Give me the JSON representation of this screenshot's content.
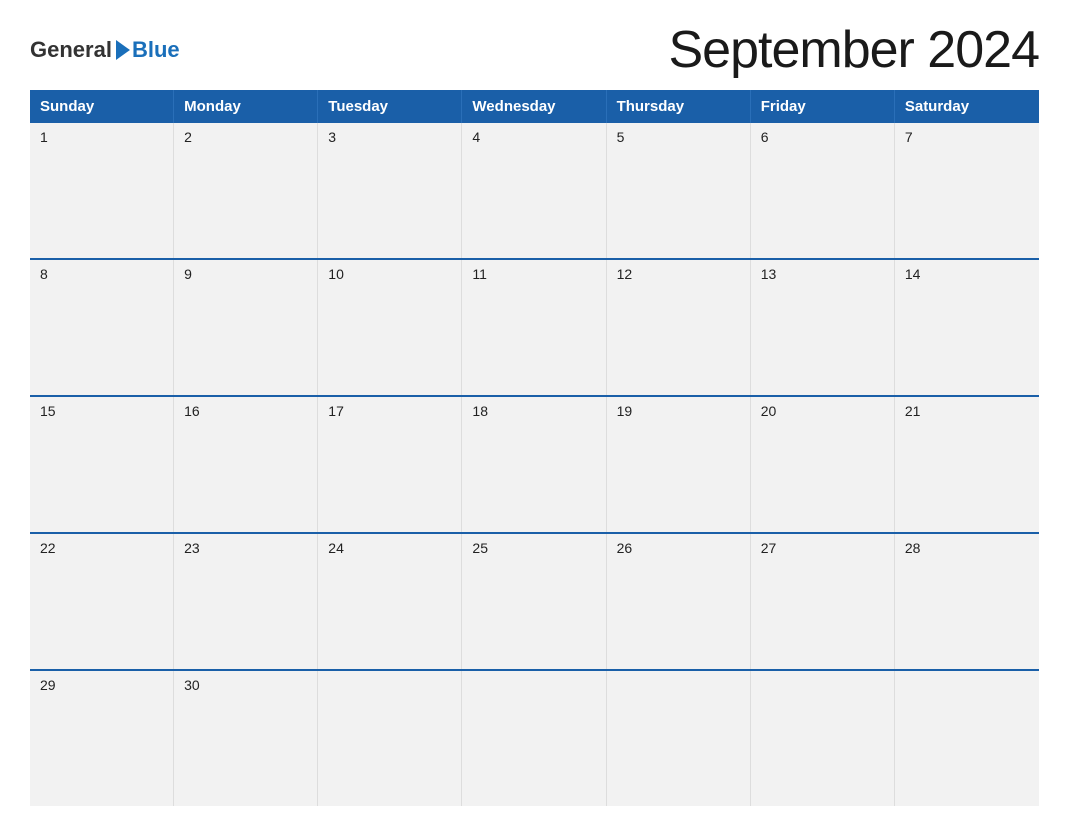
{
  "logo": {
    "general": "General",
    "blue": "Blue"
  },
  "title": "September 2024",
  "header": {
    "days": [
      "Sunday",
      "Monday",
      "Tuesday",
      "Wednesday",
      "Thursday",
      "Friday",
      "Saturday"
    ]
  },
  "weeks": [
    [
      {
        "day": "1"
      },
      {
        "day": "2"
      },
      {
        "day": "3"
      },
      {
        "day": "4"
      },
      {
        "day": "5"
      },
      {
        "day": "6"
      },
      {
        "day": "7"
      }
    ],
    [
      {
        "day": "8"
      },
      {
        "day": "9"
      },
      {
        "day": "10"
      },
      {
        "day": "11"
      },
      {
        "day": "12"
      },
      {
        "day": "13"
      },
      {
        "day": "14"
      }
    ],
    [
      {
        "day": "15"
      },
      {
        "day": "16"
      },
      {
        "day": "17"
      },
      {
        "day": "18"
      },
      {
        "day": "19"
      },
      {
        "day": "20"
      },
      {
        "day": "21"
      }
    ],
    [
      {
        "day": "22"
      },
      {
        "day": "23"
      },
      {
        "day": "24"
      },
      {
        "day": "25"
      },
      {
        "day": "26"
      },
      {
        "day": "27"
      },
      {
        "day": "28"
      }
    ],
    [
      {
        "day": "29"
      },
      {
        "day": "30"
      },
      {
        "day": ""
      },
      {
        "day": ""
      },
      {
        "day": ""
      },
      {
        "day": ""
      },
      {
        "day": ""
      }
    ]
  ]
}
